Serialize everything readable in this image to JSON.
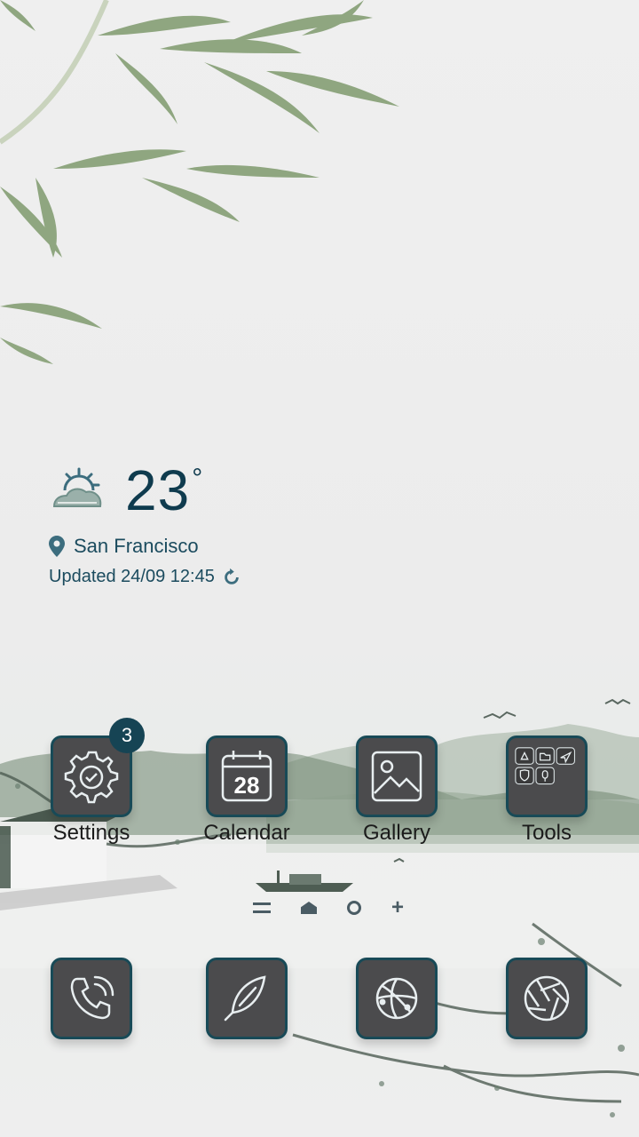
{
  "weather": {
    "temperature": "23",
    "degree_symbol": "°",
    "city": "San Francisco",
    "updated": "Updated 24/09 12:45",
    "icon": "partly-sunny-icon"
  },
  "apps": {
    "settings": {
      "label": "Settings",
      "badge": "3",
      "icon": "gear-check-icon"
    },
    "calendar": {
      "label": "Calendar",
      "day": "28",
      "icon": "calendar-icon"
    },
    "gallery": {
      "label": "Gallery",
      "icon": "image-icon"
    },
    "tools": {
      "label": "Tools",
      "icon": "folder-icon"
    }
  },
  "dock": [
    {
      "name": "phone",
      "icon": "phone-icon"
    },
    {
      "name": "notes",
      "icon": "feather-icon"
    },
    {
      "name": "browser",
      "icon": "globe-icon"
    },
    {
      "name": "camera",
      "icon": "aperture-icon"
    }
  ],
  "page_indicator": {
    "plus": "+"
  },
  "colors": {
    "tile_bg": "#4b4b4d",
    "tile_border": "#184a57",
    "accent": "#0f3b4e",
    "bamboo": "#7f9a6d",
    "mountain": "#8aa08a"
  }
}
